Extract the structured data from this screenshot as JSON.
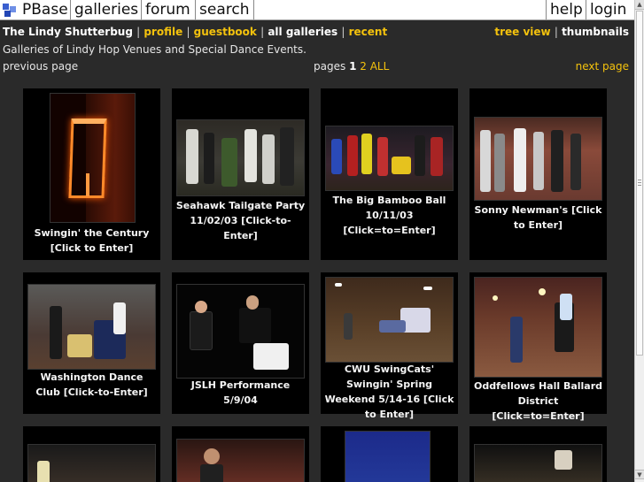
{
  "nav": {
    "logo": "PBase",
    "tabs": [
      "galleries",
      "forum",
      "search"
    ],
    "right_tabs": [
      "help",
      "login"
    ]
  },
  "header": {
    "owner": "The Lindy Shutterbug",
    "links": [
      "profile",
      "guestbook",
      "all galleries",
      "recent"
    ],
    "view_tree": "tree view",
    "view_thumbs": "thumbnails",
    "separator": "|"
  },
  "description": "Galleries of Lindy Hop Venues and Special Dance Events.",
  "pager": {
    "previous": "previous page",
    "pages_label": "pages",
    "current": "1",
    "other": "2",
    "all": "ALL",
    "next": "next page"
  },
  "galleries": [
    {
      "title": "Swingin' the Century [Click to Enter]"
    },
    {
      "title": "Seahawk Tailgate Party 11/02/03 [Click-to-Enter]"
    },
    {
      "title": "The Big Bamboo Ball 10/11/03 [Click=to=Enter]"
    },
    {
      "title": "Sonny Newman's [Click to Enter]"
    },
    {
      "title": "Washington Dance Club [Click-to-Enter]"
    },
    {
      "title": "JSLH Performance 5/9/04"
    },
    {
      "title": "CWU SwingCats' Swingin' Spring Weekend 5/14-16 [Click to Enter]"
    },
    {
      "title": "Oddfellows Hall Ballard District [Click=to=Enter]"
    },
    {
      "title": ""
    },
    {
      "title": ""
    },
    {
      "title": ""
    },
    {
      "title": ""
    }
  ],
  "colors": {
    "background": "#2a2a2a",
    "tile": "#000000",
    "link": "#f4c20d",
    "text": "#e6e6e6"
  }
}
